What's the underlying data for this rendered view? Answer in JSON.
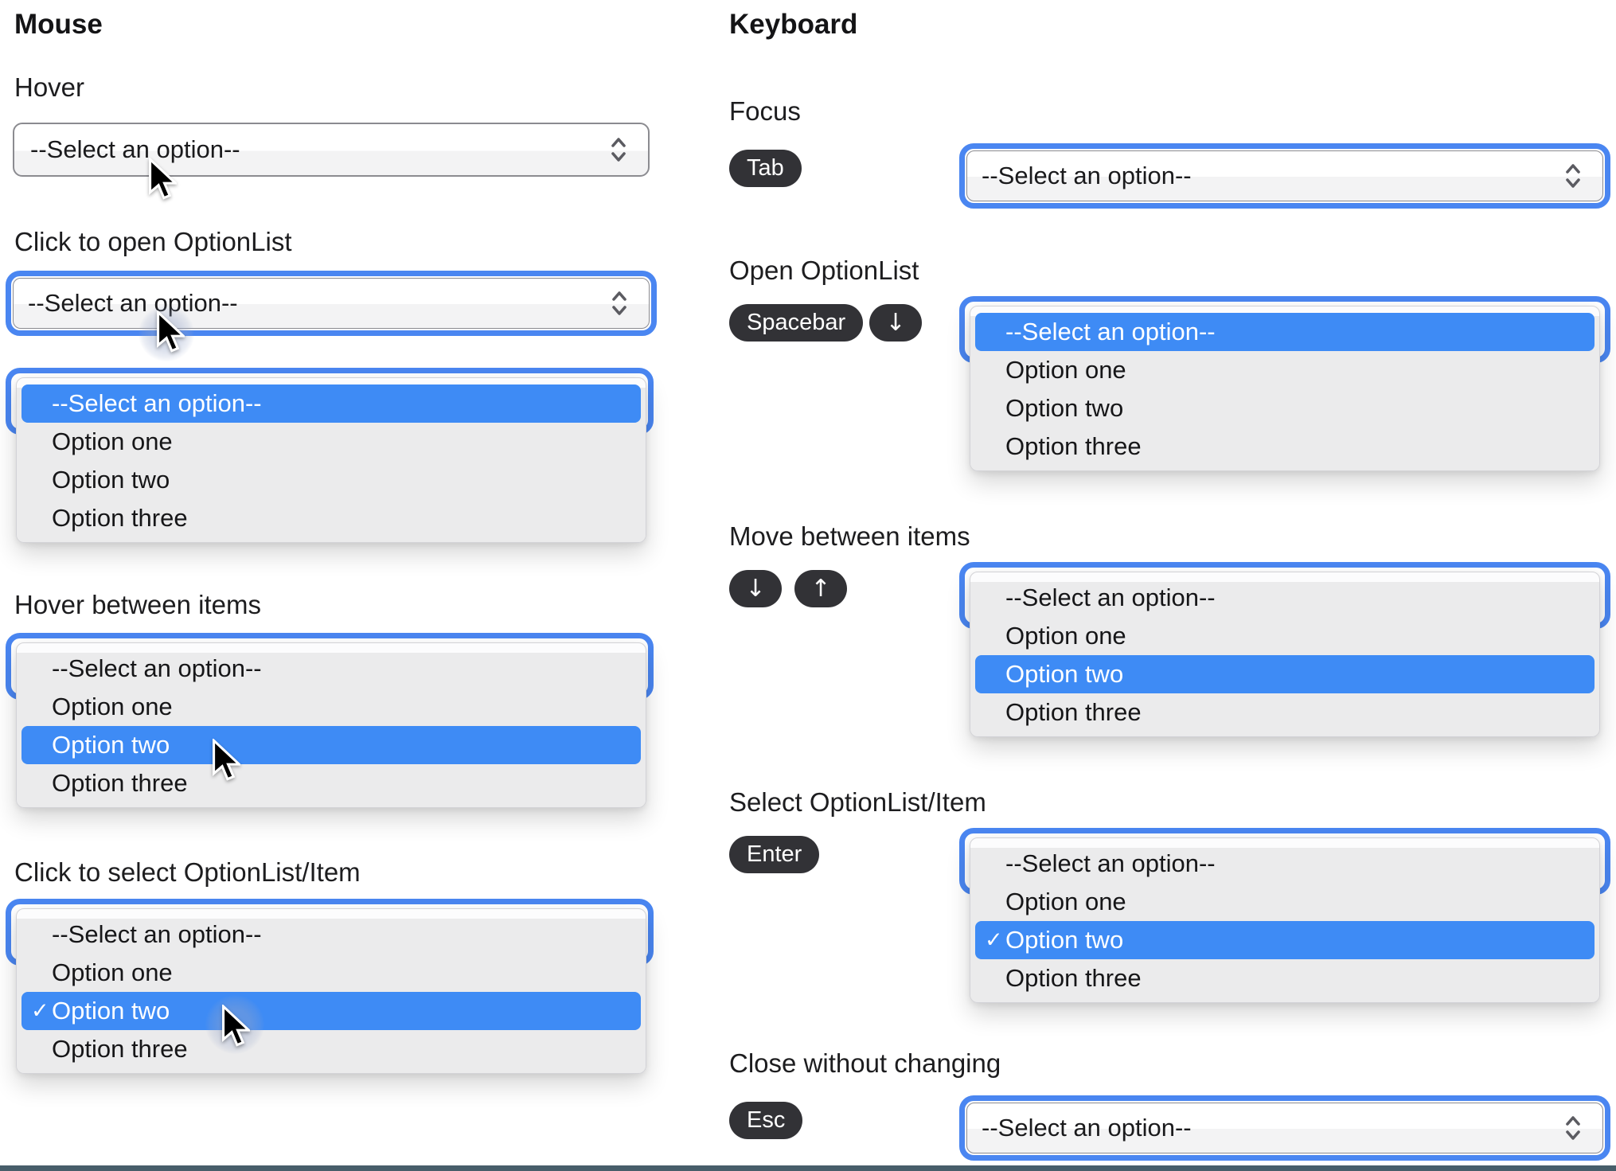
{
  "options": [
    "--Select an option--",
    "Option one",
    "Option two",
    "Option three"
  ],
  "select_placeholder": "--Select an option--",
  "check_glyph": "✓",
  "mouse": {
    "title": "Mouse",
    "hover_label": "Hover",
    "click_open_label": "Click to open OptionList",
    "hover_items_label": "Hover between items",
    "click_select_label": "Click to select OptionList/Item"
  },
  "keyboard": {
    "title": "Keyboard",
    "focus_label": "Focus",
    "open_label": "Open OptionList",
    "move_label": "Move between items",
    "select_label": "Select OptionList/Item",
    "close_label": "Close without changing",
    "keys": {
      "tab": "Tab",
      "spacebar": "Spacebar",
      "enter": "Enter",
      "esc": "Esc",
      "down": "↓",
      "up": "↑"
    }
  },
  "colors": {
    "highlight_blue": "#3e8bf5",
    "focus_ring_blue": "#4a86f1",
    "panel_gray": "#ebebec",
    "key_chip_dark": "#323236",
    "bottom_bar": "#475e6a"
  }
}
